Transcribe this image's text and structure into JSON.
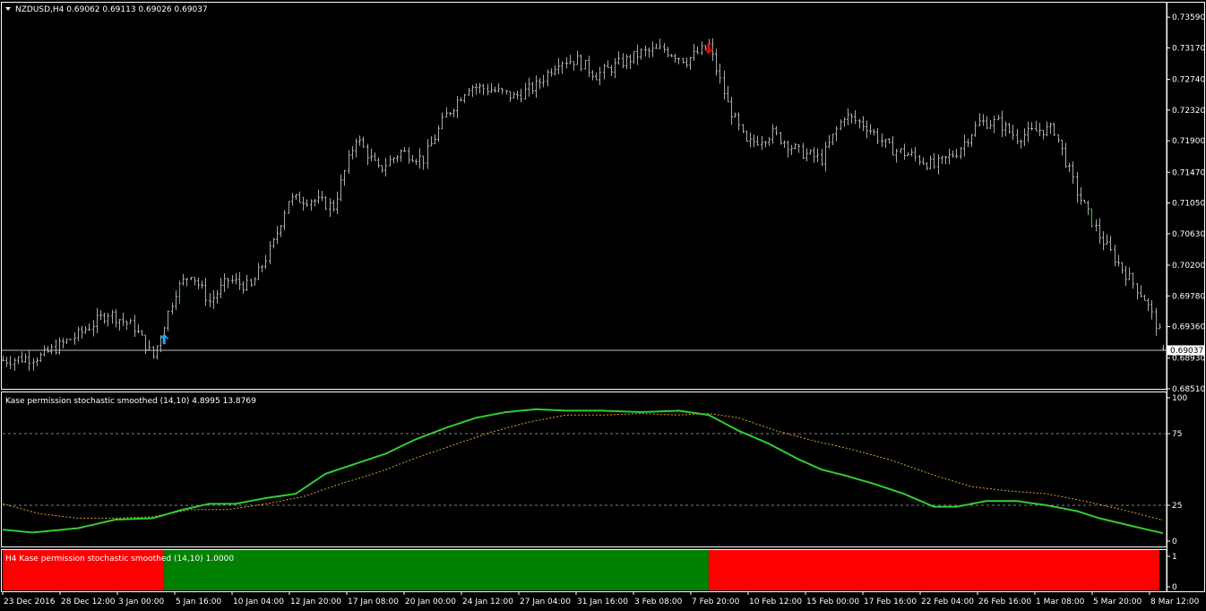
{
  "main_panel": {
    "header": "NZDUSD,H4  0.69062 0.69113 0.69026 0.69037",
    "price_labels": [
      "0.73590",
      "0.73170",
      "0.72740",
      "0.72320",
      "0.71900",
      "0.71470",
      "0.71050",
      "0.70630",
      "0.70200",
      "0.69780",
      "0.69360",
      "0.68930",
      "0.68510"
    ],
    "current_price": "0.69037",
    "arrows": [
      {
        "type": "up",
        "color": "#1EA8F0",
        "bar": 43
      },
      {
        "type": "down",
        "color": "#FF0000",
        "bar": 188
      }
    ]
  },
  "stoch_panel": {
    "header": "Kase permission stochastic smoothed (14,10) 4.8995 13.8769",
    "levels": [
      "100",
      "75",
      "25",
      "0"
    ],
    "line_colors": {
      "main": "#32CD32",
      "signal": "#DAA520"
    }
  },
  "hist_panel": {
    "header": "H4 Kase permission stochastic smoothed (14,10) 1.0000",
    "levels": [
      "1",
      "0"
    ],
    "segments": [
      {
        "color": "#FF0000",
        "from": 0,
        "to": 43
      },
      {
        "color": "#008000",
        "from": 43,
        "to": 188
      },
      {
        "color": "#FF0000",
        "from": 188,
        "to": 310
      }
    ]
  },
  "time_axis": [
    "23 Dec 2016",
    "28 Dec 12:00",
    "3 Jan 00:00",
    "5 Jan 16:00",
    "10 Jan 04:00",
    "12 Jan 20:00",
    "17 Jan 08:00",
    "20 Jan 00:00",
    "24 Jan 12:00",
    "27 Jan 04:00",
    "31 Jan 16:00",
    "3 Feb 08:00",
    "7 Feb 20:00",
    "10 Feb 12:00",
    "15 Feb 00:00",
    "17 Feb 16:00",
    "22 Feb 04:00",
    "26 Feb 16:00",
    "1 Mar 08:00",
    "5 Mar 20:00",
    "8 Mar 12:00"
  ],
  "chart_data": {
    "type": "line",
    "symbol": "NZDUSD",
    "timeframe": "H4",
    "ohlc_last": {
      "open": 0.69062,
      "high": 0.69113,
      "low": 0.69026,
      "close": 0.69037
    },
    "price_axis_range": [
      0.6851,
      0.738
    ],
    "close_keypoints": [
      [
        0,
        0.689
      ],
      [
        10,
        0.6895
      ],
      [
        20,
        0.6925
      ],
      [
        28,
        0.6955
      ],
      [
        35,
        0.6935
      ],
      [
        40,
        0.6895
      ],
      [
        46,
        0.6985
      ],
      [
        50,
        0.701
      ],
      [
        55,
        0.697
      ],
      [
        60,
        0.7
      ],
      [
        66,
        0.699
      ],
      [
        72,
        0.705
      ],
      [
        76,
        0.711
      ],
      [
        82,
        0.711
      ],
      [
        88,
        0.71
      ],
      [
        94,
        0.7195
      ],
      [
        100,
        0.715
      ],
      [
        106,
        0.7175
      ],
      [
        112,
        0.7165
      ],
      [
        118,
        0.7225
      ],
      [
        124,
        0.7265
      ],
      [
        130,
        0.726
      ],
      [
        136,
        0.725
      ],
      [
        142,
        0.7265
      ],
      [
        148,
        0.73
      ],
      [
        153,
        0.73
      ],
      [
        158,
        0.728
      ],
      [
        164,
        0.7295
      ],
      [
        170,
        0.731
      ],
      [
        176,
        0.7315
      ],
      [
        182,
        0.73
      ],
      [
        188,
        0.732
      ],
      [
        193,
        0.724
      ],
      [
        198,
        0.7185
      ],
      [
        205,
        0.72
      ],
      [
        212,
        0.7175
      ],
      [
        218,
        0.7165
      ],
      [
        224,
        0.7225
      ],
      [
        230,
        0.721
      ],
      [
        236,
        0.718
      ],
      [
        242,
        0.717
      ],
      [
        248,
        0.7155
      ],
      [
        254,
        0.7175
      ],
      [
        260,
        0.7215
      ],
      [
        265,
        0.7215
      ],
      [
        270,
        0.7195
      ],
      [
        276,
        0.7205
      ],
      [
        280,
        0.7205
      ],
      [
        286,
        0.712
      ],
      [
        292,
        0.706
      ],
      [
        298,
        0.7015
      ],
      [
        304,
        0.6975
      ],
      [
        310,
        0.6904
      ]
    ],
    "stoch_axis_range": [
      0,
      100
    ],
    "series": [
      {
        "name": "main",
        "values": [
          [
            0,
            8
          ],
          [
            8,
            6
          ],
          [
            20,
            9
          ],
          [
            30,
            15
          ],
          [
            40,
            16
          ],
          [
            48,
            22
          ],
          [
            55,
            26
          ],
          [
            62,
            26
          ],
          [
            70,
            30
          ],
          [
            78,
            33
          ],
          [
            86,
            47
          ],
          [
            94,
            54
          ],
          [
            102,
            61
          ],
          [
            110,
            71
          ],
          [
            118,
            79
          ],
          [
            126,
            86
          ],
          [
            134,
            90
          ],
          [
            142,
            92
          ],
          [
            150,
            91
          ],
          [
            160,
            91
          ],
          [
            170,
            90
          ],
          [
            180,
            91
          ],
          [
            188,
            88
          ],
          [
            196,
            77
          ],
          [
            204,
            68
          ],
          [
            212,
            57
          ],
          [
            218,
            50
          ],
          [
            224,
            46
          ],
          [
            232,
            40
          ],
          [
            240,
            33
          ],
          [
            248,
            24
          ],
          [
            254,
            24
          ],
          [
            262,
            28
          ],
          [
            270,
            28
          ],
          [
            278,
            25
          ],
          [
            286,
            21
          ],
          [
            292,
            16
          ],
          [
            300,
            11
          ],
          [
            310,
            4.9
          ]
        ]
      },
      {
        "name": "signal",
        "values": [
          [
            0,
            26
          ],
          [
            10,
            19
          ],
          [
            20,
            16
          ],
          [
            30,
            16
          ],
          [
            40,
            17
          ],
          [
            50,
            22
          ],
          [
            60,
            22
          ],
          [
            70,
            26
          ],
          [
            80,
            31
          ],
          [
            90,
            40
          ],
          [
            100,
            48
          ],
          [
            110,
            58
          ],
          [
            120,
            67
          ],
          [
            130,
            76
          ],
          [
            140,
            83
          ],
          [
            150,
            88
          ],
          [
            160,
            88
          ],
          [
            170,
            89
          ],
          [
            180,
            88
          ],
          [
            188,
            89
          ],
          [
            196,
            86
          ],
          [
            206,
            77
          ],
          [
            216,
            70
          ],
          [
            226,
            64
          ],
          [
            236,
            57
          ],
          [
            248,
            46
          ],
          [
            258,
            38
          ],
          [
            268,
            35
          ],
          [
            278,
            33
          ],
          [
            288,
            28
          ],
          [
            298,
            22
          ],
          [
            310,
            13.9
          ]
        ]
      }
    ],
    "levels": [
      0,
      25,
      75,
      100
    ],
    "n_bars": 310
  }
}
